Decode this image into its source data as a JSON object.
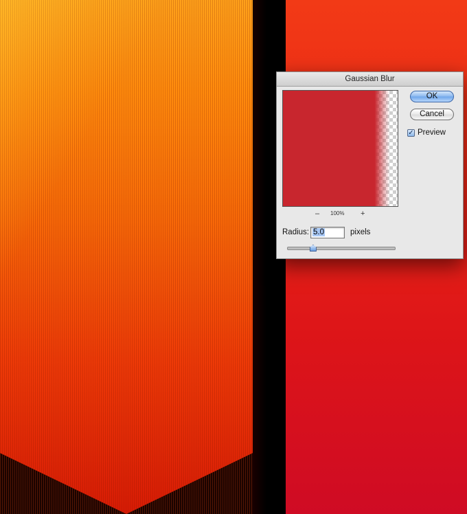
{
  "dialog": {
    "title": "Gaussian Blur",
    "ok_label": "OK",
    "cancel_label": "Cancel",
    "preview_label": "Preview",
    "preview_checked": true,
    "zoom_out_label": "–",
    "zoom_level": "100%",
    "zoom_in_label": "+",
    "radius_label": "Radius:",
    "radius_value": "5.0",
    "unit_label": "pixels",
    "slider_position": 0.24
  },
  "colors": {
    "preview_fill": "#c8262e",
    "ok_button_accent": "#6ea5ea",
    "canvas_orange": "#ff8a0c",
    "canvas_red": "#e11b17"
  },
  "icons": {
    "preview_checkbox": "check-icon",
    "slider_handle": "slider-thumb-icon"
  }
}
